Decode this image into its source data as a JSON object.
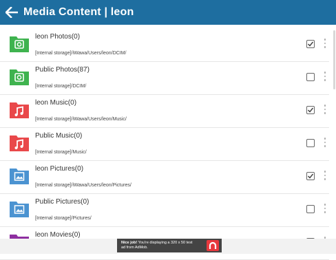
{
  "header": {
    "title": "Media Content | leon"
  },
  "items": [
    {
      "name": "leon Photos(0)",
      "path": "[Internal storage]/iWawa/Users/leon/DCIM/",
      "checked": true,
      "icon": "photo-folder-icon",
      "color": "#3fb34f"
    },
    {
      "name": "Public Photos(87)",
      "path": "[Internal storage]/DCIM/",
      "checked": false,
      "icon": "photo-folder-icon",
      "color": "#3fb34f"
    },
    {
      "name": "leon Music(0)",
      "path": "[Internal storage]/iWawa/Users/leon/Music/",
      "checked": true,
      "icon": "music-folder-icon",
      "color": "#e9484a"
    },
    {
      "name": "Public Music(0)",
      "path": "[Internal storage]/Music/",
      "checked": false,
      "icon": "music-folder-icon",
      "color": "#e9484a"
    },
    {
      "name": "leon Pictures(0)",
      "path": "[Internal storage]/iWawa/Users/leon/Pictures/",
      "checked": true,
      "icon": "pictures-folder-icon",
      "color": "#4b93d1"
    },
    {
      "name": "Public Pictures(0)",
      "path": "[Internal storage]/Pictures/",
      "checked": false,
      "icon": "pictures-folder-icon",
      "color": "#4b93d1"
    },
    {
      "name": "leon Movies(0)",
      "path": "",
      "checked": false,
      "icon": "movies-folder-icon",
      "color": "#8e2fa0"
    }
  ],
  "ad": {
    "text_bold": "Nice job!",
    "text": " You're displaying a 320 x 50 test ad from AdMob."
  }
}
